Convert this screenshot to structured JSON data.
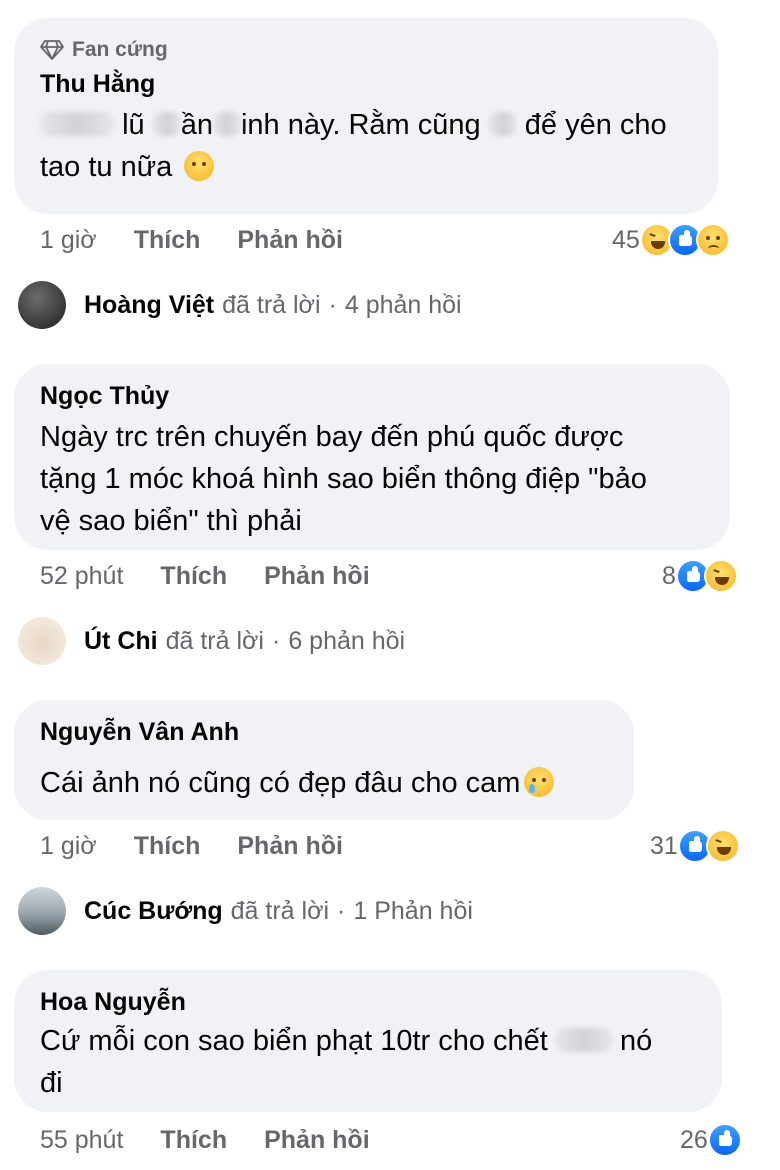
{
  "comments": [
    {
      "badge": "Fan cứng",
      "author": "Thu Hằng",
      "line1_seg1": "lũ",
      "line1_seg2": "ần",
      "line1_seg3": "inh này. Rằm cũng",
      "line1_seg4": "để yên cho",
      "line2": "tao tu nữa",
      "emoji": "sneezing-face-icon",
      "time": "1 giờ",
      "like_label": "Thích",
      "reply_label": "Phản hồi",
      "reaction_count": "45",
      "reactions": [
        "haha",
        "like",
        "sad"
      ]
    },
    {
      "author": "Ngọc Thủy",
      "lines": [
        "Ngày trc trên chuyến bay đến phú quốc được",
        "tặng 1 móc khoá hình sao biển thông điệp \"bảo",
        "vệ sao biển\" thì phải"
      ],
      "time": "52 phút",
      "like_label": "Thích",
      "reply_label": "Phản hồi",
      "reaction_count": "8",
      "reactions": [
        "like",
        "haha"
      ]
    },
    {
      "author": "Nguyễn Vân Anh",
      "text": "Cái ảnh nó cũng có đẹp đâu cho cam",
      "emoji": "crying-face-icon",
      "time": "1 giờ",
      "like_label": "Thích",
      "reply_label": "Phản hồi",
      "reaction_count": "31",
      "reactions": [
        "like",
        "haha"
      ]
    },
    {
      "author": "Hoa Nguyễn",
      "line1_seg1": "Cứ mỗi con sao biển phạt 10tr cho chết",
      "line1_seg2": "nó",
      "line2": "đi",
      "time": "55 phút",
      "like_label": "Thích",
      "reply_label": "Phản hồi",
      "reaction_count": "26",
      "reactions": [
        "like"
      ]
    }
  ],
  "replies": [
    {
      "name": "Hoàng Việt",
      "text": "đã trả lời",
      "dot": "·",
      "count": "4 phản hồi"
    },
    {
      "name": "Út Chi",
      "text": "đã trả lời",
      "dot": "·",
      "count": "6 phản hồi"
    },
    {
      "name": "Cúc Bướng",
      "text": "đã trả lời",
      "dot": "·",
      "count": "1 Phản hồi"
    }
  ],
  "colors": {
    "bubble": "#f0f2f5",
    "meta": "#65676b",
    "like": "#0866ff",
    "haha": "#f7b125"
  }
}
